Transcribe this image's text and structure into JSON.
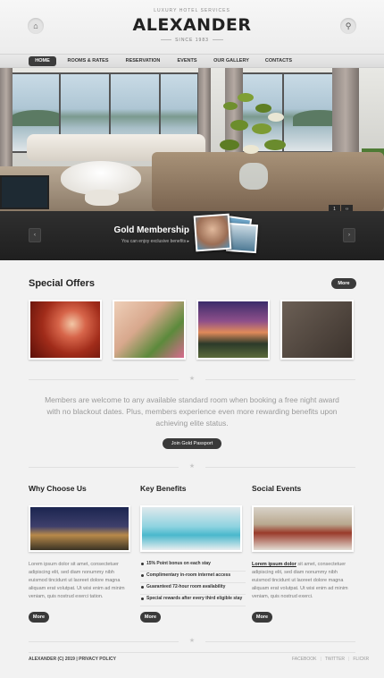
{
  "header": {
    "tagline": "LUXURY HOTEL SERVICES",
    "logo": "ALEXANDER",
    "since": "SINCE 1983",
    "home_icon": "home-icon",
    "search_icon": "search-icon"
  },
  "nav": {
    "items": [
      "HOME",
      "ROOMS & RATES",
      "RESERVATION",
      "EVENTS",
      "OUR GALLERY",
      "CONTACTS"
    ],
    "active": "HOME"
  },
  "slider": {
    "page": "1",
    "prev": "‹",
    "next": "›"
  },
  "membership": {
    "title": "Gold Membership",
    "subtitle": "You can enjoy exclusive benefits ▸",
    "prev": "‹",
    "next": "›"
  },
  "special_offers": {
    "title": "Special Offers",
    "more": "More"
  },
  "intro": {
    "text": "Members are welcome to any available standard room when booking a free night award with no blackout dates. Plus, members experience even more rewarding benefits upon achieving elite status.",
    "button": "Join Gold Passport"
  },
  "columns": {
    "why": {
      "title": "Why Choose Us",
      "text": "Lorem ipsum dolor sit amet, consectetuer adipiscing elit, sed diam nonummy nibh euismod tincidunt ut laoreet dolore magna aliquam erat volutpat. Ut wisi enim ad minim veniam, quis nostrud exerci tation.",
      "more": "More"
    },
    "benefits": {
      "title": "Key Benefits",
      "items": [
        "15% Point bonus on each stay",
        "Complimentary in-room internet access",
        "Guaranteed 72-hour room availability",
        "Special rewards after every third eligible stay"
      ],
      "more": "More"
    },
    "events": {
      "title": "Social Events",
      "lead": "Lorem ipsum dolor",
      "text": " sit amet, consectetuer adipiscing elit, sed diam nonummy nibh euismod tincidunt ut laoreet dolore magna aliquam erat volutpat. Ut wisi enim ad minim veniam, quis nostrud exerci.",
      "more": "More"
    }
  },
  "footer": {
    "copyright": "ALEXANDER (C) 2019 | PRIVACY POLICY",
    "links": [
      "FACEBOOK",
      "TWITTER",
      "FLICKR"
    ]
  }
}
